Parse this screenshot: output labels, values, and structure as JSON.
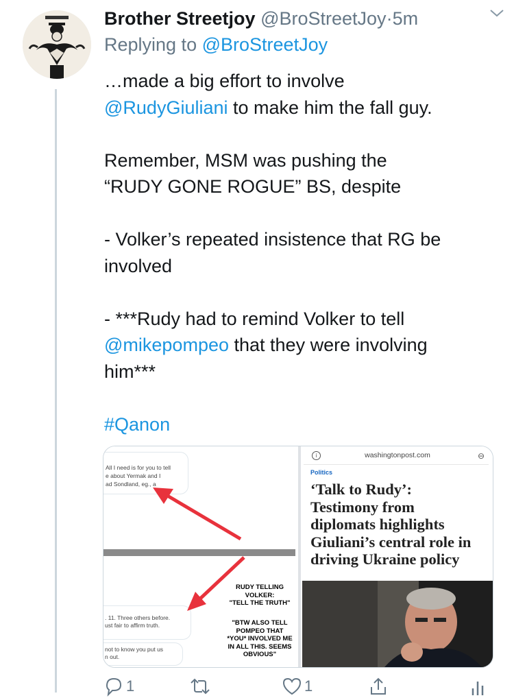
{
  "tweet": {
    "author_name": "Brother Streetjoy",
    "author_handle": "@BroStreetJoy",
    "separator": "·",
    "time": "5m",
    "replying_prefix": "Replying to",
    "replying_handle": "@BroStreetJoy",
    "body": {
      "line1": "…made a big effort to involve",
      "line2_mention": "@RudyGiuliani",
      "line2_rest": " to make him the fall guy.",
      "p2_line1": "Remember, MSM was pushing the",
      "p2_line2": "“RUDY GONE ROGUE” BS, despite",
      "p3_line1": "- Volker’s repeated insistence that RG be",
      "p3_line2": "involved",
      "p4_line1": "- ***Rudy had to remind Volker to tell",
      "p4_mention": "@mikepompeo",
      "p4_line2_rest": " that they were involving",
      "p4_line3": "him***",
      "hashtag": "#Qanon"
    }
  },
  "media": {
    "left": {
      "chat_top": [
        "All I need is for you to tell",
        "e about Yermak and I",
        "ad Sondland, eg., a"
      ],
      "chat_mid": [
        ". 11. Three others before.",
        "ust fair to affirm truth."
      ],
      "chat_bot": [
        "not to know you put us",
        "n out."
      ],
      "caption1": [
        "RUDY TELLING",
        "VOLKER:",
        "\"TELL THE TRUTH\""
      ],
      "caption2": [
        "\"BTW ALSO TELL",
        "POMPEO THAT",
        "*YOU* INVOLVED ME",
        "IN ALL THIS. SEEMS",
        "OBVIOUS\""
      ]
    },
    "right": {
      "url": "washingtonpost.com",
      "section": "Politics",
      "headline": [
        "‘Talk to Rudy’:",
        "Testimony from",
        "diplomats highlights",
        "Giuliani’s central role in",
        "driving Ukraine policy"
      ]
    }
  },
  "actions": {
    "reply_count": "1",
    "retweet_count": "",
    "like_count": "1",
    "share_count": ""
  },
  "colors": {
    "link": "#1b95e0",
    "muted": "#657786",
    "arrow": "#e8323c",
    "wapo_section": "#1565c0"
  },
  "icons": [
    "chevron-down-icon",
    "info-icon",
    "link-icon",
    "reply-icon",
    "retweet-icon",
    "like-icon",
    "share-icon",
    "analytics-icon"
  ]
}
